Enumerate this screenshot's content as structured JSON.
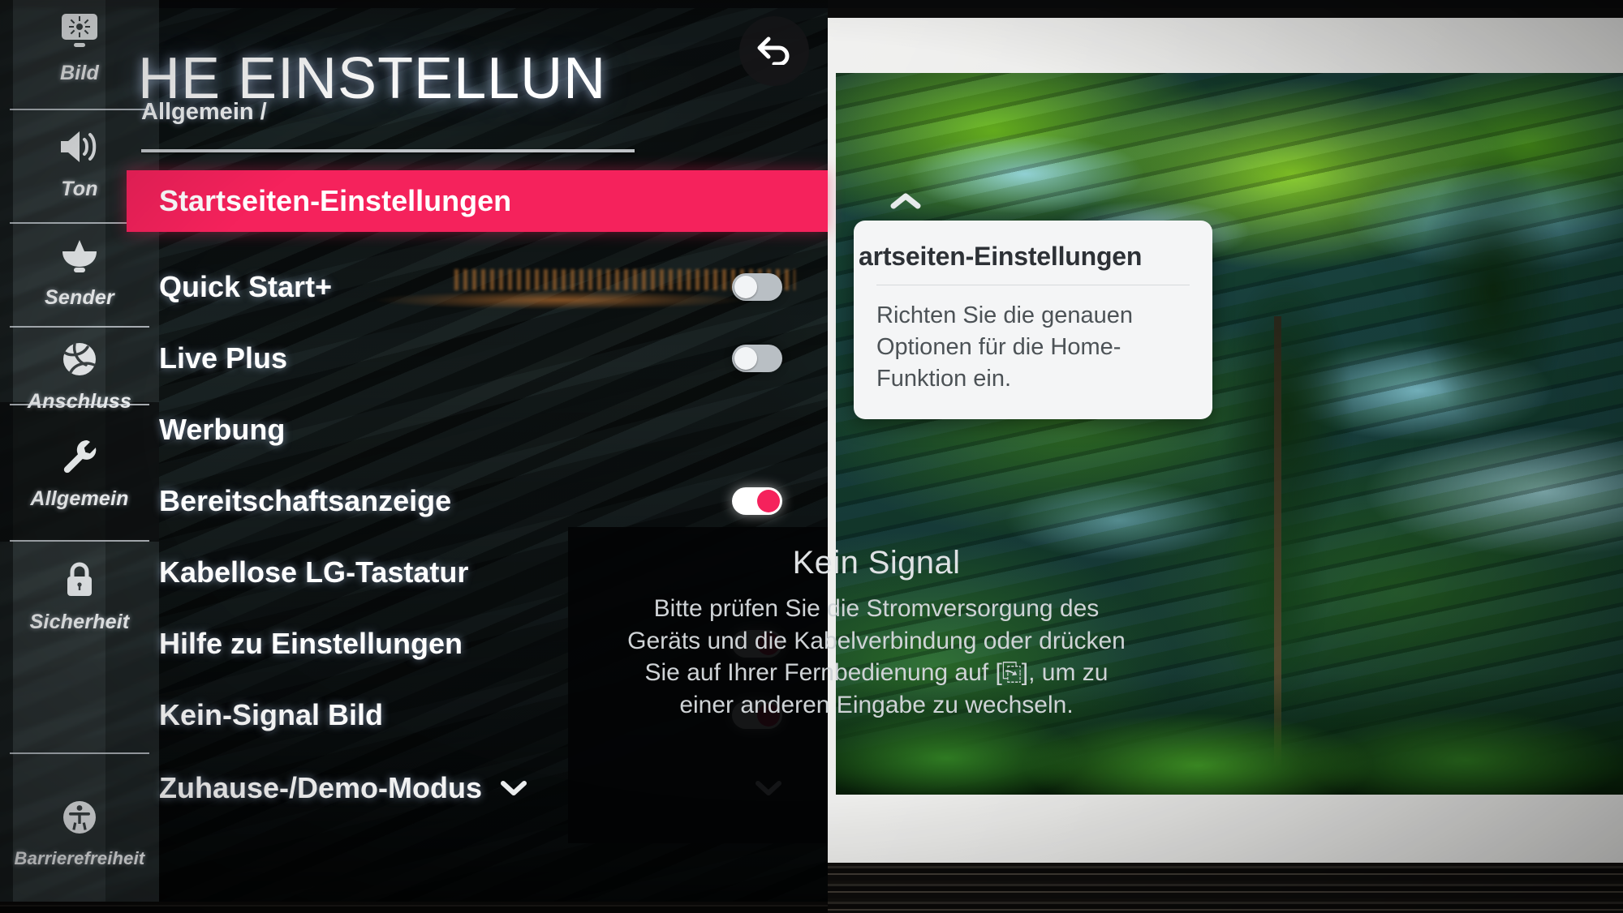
{
  "screen": {
    "title": "HE EINSTELLUN",
    "title_full_hint": "ALLE EINSTELLUNGEN",
    "breadcrumb": "Allgemein /",
    "back_icon": "back-arrow-icon"
  },
  "sidebar": {
    "items": [
      {
        "label": "Bild",
        "icon": "picture-brightness-icon",
        "active": false
      },
      {
        "label": "Ton",
        "icon": "speaker-volume-icon",
        "active": false
      },
      {
        "label": "Sender",
        "icon": "satellite-dish-icon",
        "active": false
      },
      {
        "label": "Anschluss",
        "icon": "network-globe-icon",
        "active": false
      },
      {
        "label": "Allgemein",
        "icon": "wrench-icon",
        "active": true
      },
      {
        "label": "Sicherheit",
        "icon": "lock-icon",
        "active": false
      },
      {
        "label": "Barrierefreiheit",
        "icon": "accessibility-icon",
        "active": false
      }
    ]
  },
  "settings_list": {
    "rows": [
      {
        "label": "Startseiten-Einstellungen",
        "highlighted": true,
        "control": "chevron-up",
        "toggle": null
      },
      {
        "label": "Quick Start+",
        "highlighted": false,
        "control": "toggle",
        "toggle": "off"
      },
      {
        "label": "Live Plus",
        "highlighted": false,
        "control": "toggle",
        "toggle": "off"
      },
      {
        "label": "Werbung",
        "highlighted": false,
        "control": "none",
        "toggle": null
      },
      {
        "label": "Bereitschaftsanzeige",
        "highlighted": false,
        "control": "toggle",
        "toggle": "on"
      },
      {
        "label": "Kabellose LG-Tastatur",
        "highlighted": false,
        "control": "none",
        "toggle": null
      },
      {
        "label": "Hilfe zu Einstellungen",
        "highlighted": false,
        "control": "toggle",
        "toggle": "on"
      },
      {
        "label": "Kein-Signal Bild",
        "highlighted": false,
        "control": "toggle",
        "toggle": "on"
      },
      {
        "label": "Zuhause-/Demo-Modus",
        "highlighted": false,
        "control": "chevron-down-double",
        "toggle": null
      }
    ]
  },
  "tooltip": {
    "title": "artseiten-Einstellungen",
    "title_full_hint": "Startseiten-Einstellungen",
    "body": "Richten Sie die genauen Optionen für die Home-Funktion ein."
  },
  "no_signal": {
    "title": "Kein Signal",
    "line1": "Bitte prüfen Sie die Stromversorgung des",
    "line2": "Geräts und die Kabelverbindung oder drücken",
    "line3": "Sie auf Ihrer Fernbedienung auf [⎘], um zu",
    "line4": "einer anderen Eingabe zu wechseln."
  },
  "colors": {
    "accent_pink": "#f5225c",
    "rail_bg": "#343c3e",
    "osd_text": "#ffffff",
    "tooltip_bg": "#f4f5f6",
    "tooltip_title": "#2d3136"
  }
}
